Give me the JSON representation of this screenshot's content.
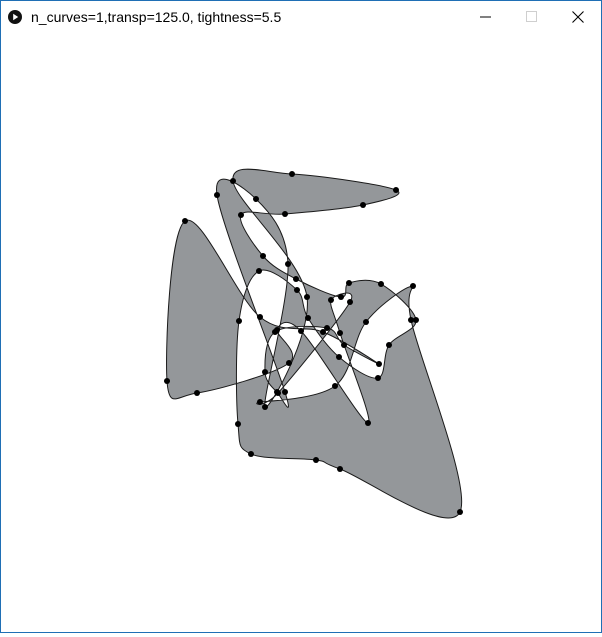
{
  "window": {
    "title": "n_curves=1,transp=125.0, tightness=5.5"
  },
  "controls": {
    "minimize_icon": "minimize-icon",
    "maximize_icon": "maximize-icon",
    "close_icon": "close-icon"
  },
  "colors": {
    "fill": "#94979a",
    "stroke": "#1a1a1a",
    "point": "#000000"
  }
}
